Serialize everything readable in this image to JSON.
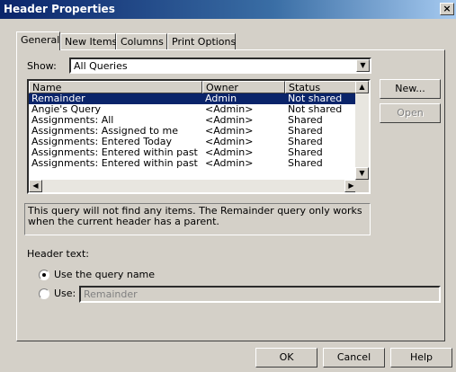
{
  "window": {
    "title": "Header Properties",
    "close_glyph": "×"
  },
  "tabs": [
    "General",
    "New Items",
    "Columns",
    "Print Options"
  ],
  "show": {
    "label": "Show:",
    "value": "All Queries"
  },
  "list": {
    "columns": [
      "Name",
      "Owner",
      "Status"
    ],
    "rows": [
      {
        "name": "Remainder",
        "owner": "Admin",
        "status": "Not shared",
        "selected": true
      },
      {
        "name": "Angie's Query",
        "owner": "<Admin>",
        "status": "Not shared"
      },
      {
        "name": "Assignments: All",
        "owner": "<Admin>",
        "status": "Shared"
      },
      {
        "name": "Assignments: Assigned to me",
        "owner": "<Admin>",
        "status": "Shared"
      },
      {
        "name": "Assignments: Entered Today",
        "owner": "<Admin>",
        "status": "Shared"
      },
      {
        "name": "Assignments: Entered within past mo…",
        "owner": "<Admin>",
        "status": "Shared"
      },
      {
        "name": "Assignments: Entered within past week",
        "owner": "<Admin>",
        "status": "Shared"
      }
    ]
  },
  "buttons": {
    "new": "New...",
    "open": "Open",
    "ok": "OK",
    "cancel": "Cancel",
    "help": "Help"
  },
  "description": "This query will not find any items. The Remainder query only works when the current header has a parent.",
  "header_text": {
    "label": "Header text:",
    "option_name": "Use the query name",
    "option_use": "Use:",
    "use_value": "Remainder",
    "selected": "option_name"
  }
}
